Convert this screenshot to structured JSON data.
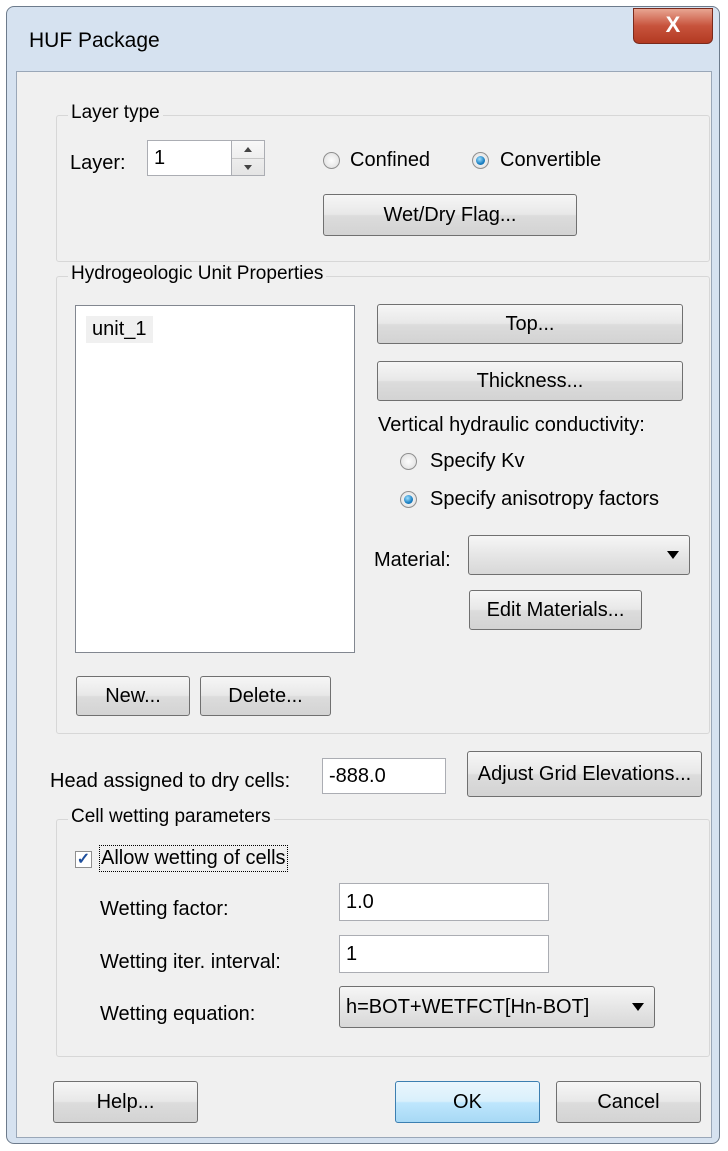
{
  "window": {
    "title": "HUF Package",
    "close_label": "X"
  },
  "layer_type": {
    "group_label": "Layer type",
    "layer_label": "Layer:",
    "layer_value": "1",
    "confined_label": "Confined",
    "convertible_label": "Convertible",
    "selected": "convertible",
    "wetdry_button": "Wet/Dry Flag..."
  },
  "hydro_units": {
    "group_label": "Hydrogeologic Unit Properties",
    "units": [
      "unit_1"
    ],
    "top_button": "Top...",
    "thickness_button": "Thickness...",
    "vk_label": "Vertical hydraulic conductivity:",
    "specify_kv_label": "Specify Kv",
    "specify_aniso_label": "Specify anisotropy factors",
    "vk_selected": "anisotropy",
    "material_label": "Material:",
    "material_value": "",
    "edit_materials_button": "Edit Materials...",
    "new_button": "New...",
    "delete_button": "Delete..."
  },
  "dry_cells": {
    "label": "Head assigned to dry cells:",
    "value": "-888.0",
    "adjust_button": "Adjust Grid Elevations..."
  },
  "wetting": {
    "group_label": "Cell wetting parameters",
    "allow_label": "Allow wetting of cells",
    "allow_checked": true,
    "factor_label": "Wetting factor:",
    "factor_value": "1.0",
    "interval_label": "Wetting iter. interval:",
    "interval_value": "1",
    "equation_label": "Wetting equation:",
    "equation_value": "h=BOT+WETFCT[Hn-BOT]"
  },
  "footer": {
    "help_button": "Help...",
    "ok_button": "OK",
    "cancel_button": "Cancel"
  }
}
